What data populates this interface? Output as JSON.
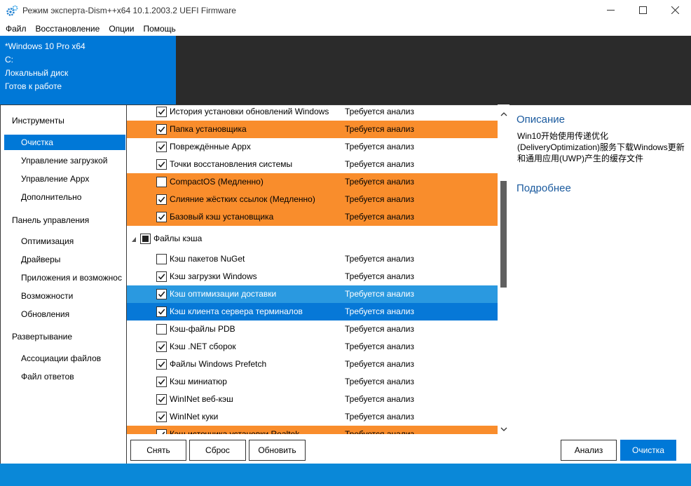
{
  "window": {
    "title": "Режим эксперта-Dism++x64 10.1.2003.2 UEFI Firmware",
    "icons": [
      "gear-icon",
      "minimize-icon",
      "maximize-icon",
      "close-icon"
    ]
  },
  "menu": [
    "Файл",
    "Восстановление",
    "Опции",
    "Помощь"
  ],
  "image_info": {
    "edition": "*Windows 10 Pro x64",
    "drive": "C:",
    "disk": "Локальный диск",
    "status": "Готов к работе"
  },
  "sidebar": {
    "sections": [
      {
        "title": "Инструменты",
        "items": [
          "Очистка",
          "Управление загрузкой",
          "Управление Appx",
          "Дополнительно"
        ]
      },
      {
        "title": "Панель управления",
        "items": [
          "Оптимизация",
          "Драйверы",
          "Приложения и возможнос",
          "Возможности",
          "Обновления"
        ]
      },
      {
        "title": "Развертывание",
        "items": [
          "Ассоциации файлов",
          "Файл ответов"
        ]
      }
    ],
    "active": "Очистка"
  },
  "list": {
    "group": "Файлы кэша",
    "rows": [
      {
        "name": "История установки обновлений Windows",
        "status": "Требуется анализ",
        "checked": true,
        "style": "normal"
      },
      {
        "name": "Папка установщика",
        "status": "Требуется анализ",
        "checked": true,
        "style": "orange"
      },
      {
        "name": "Повреждённые Appx",
        "status": "Требуется анализ",
        "checked": true,
        "style": "normal"
      },
      {
        "name": "Точки восстановления системы",
        "status": "Требуется анализ",
        "checked": true,
        "style": "normal"
      },
      {
        "name": "CompactOS (Медленно)",
        "status": "Требуется анализ",
        "checked": false,
        "style": "orange"
      },
      {
        "name": "Слияние жёстких ссылок (Медленно)",
        "status": "Требуется анализ",
        "checked": true,
        "style": "orange"
      },
      {
        "name": "Базовый кэш установщика",
        "status": "Требуется анализ",
        "checked": true,
        "style": "orange"
      },
      {
        "name": "Кэш пакетов NuGet",
        "status": "Требуется анализ",
        "checked": false,
        "style": "normal"
      },
      {
        "name": "Кэш загрузки Windows",
        "status": "Требуется анализ",
        "checked": true,
        "style": "normal"
      },
      {
        "name": "Кэш оптимизации доставки",
        "status": "Требуется анализ",
        "checked": true,
        "style": "selblue"
      },
      {
        "name": "Кэш клиента сервера терминалов",
        "status": "Требуется анализ",
        "checked": true,
        "style": "darkblue"
      },
      {
        "name": "Кэш-файлы PDB",
        "status": "Требуется анализ",
        "checked": false,
        "style": "normal"
      },
      {
        "name": "Кэш .NET сборок",
        "status": "Требуется анализ",
        "checked": true,
        "style": "normal"
      },
      {
        "name": "Файлы Windows Prefetch",
        "status": "Требуется анализ",
        "checked": true,
        "style": "normal"
      },
      {
        "name": "Кэш миниатюр",
        "status": "Требуется анализ",
        "checked": true,
        "style": "normal"
      },
      {
        "name": "WinINet веб-кэш",
        "status": "Требуется анализ",
        "checked": true,
        "style": "normal"
      },
      {
        "name": "WinINet куки",
        "status": "Требуется анализ",
        "checked": true,
        "style": "normal"
      },
      {
        "name": "Кэш источника установки Realtek",
        "status": "Требуется анализ",
        "checked": true,
        "style": "orange"
      }
    ]
  },
  "description": {
    "title": "Описание",
    "text": "Win10开始使用传递优化(DeliveryOptimization)服务下载Windows更新和通用应用(UWP)产生的缓存文件",
    "more_title": "Подробнее"
  },
  "buttons": {
    "remove": "Снять",
    "reset": "Сброс",
    "refresh": "Обновить",
    "analyze": "Анализ",
    "clean": "Очистка"
  },
  "colors": {
    "accent": "#0078d7",
    "highlight_orange": "#f98d2c",
    "selection_light": "#2a99e0",
    "header_dark": "#2b2b2b"
  }
}
